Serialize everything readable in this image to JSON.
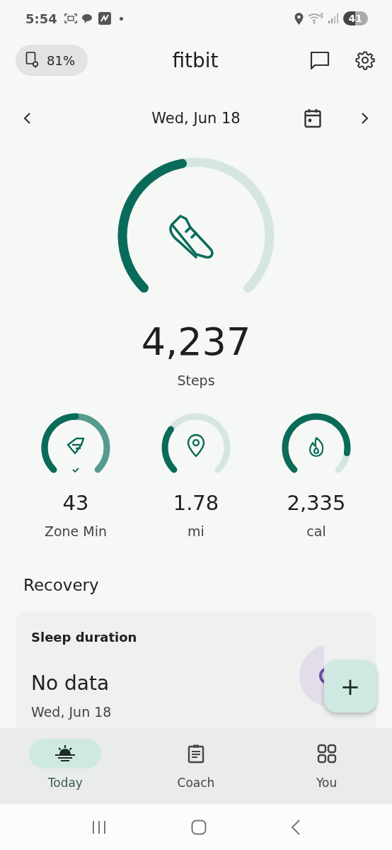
{
  "status_bar": {
    "time": "5:54",
    "battery": "41"
  },
  "header": {
    "device_battery": "81%",
    "title": "fitbit"
  },
  "date_nav": {
    "date": "Wed, Jun 18"
  },
  "steps": {
    "value": "4,237",
    "label": "Steps"
  },
  "stats": [
    {
      "kind": "zone",
      "value": "43",
      "label": "Zone Min"
    },
    {
      "kind": "distance",
      "value": "1.78",
      "label": "mi"
    },
    {
      "kind": "calories",
      "value": "2,335",
      "label": "cal"
    }
  ],
  "section_title": "Recovery",
  "sleep_card": {
    "title": "Sleep duration",
    "value": "No data",
    "date": "Wed, Jun 18"
  },
  "fab": {
    "symbol": "+"
  },
  "nav": [
    {
      "kind": "today",
      "label": "Today",
      "selected": true
    },
    {
      "kind": "coach",
      "label": "Coach",
      "selected": false
    },
    {
      "kind": "you",
      "label": "You",
      "selected": false
    }
  ]
}
